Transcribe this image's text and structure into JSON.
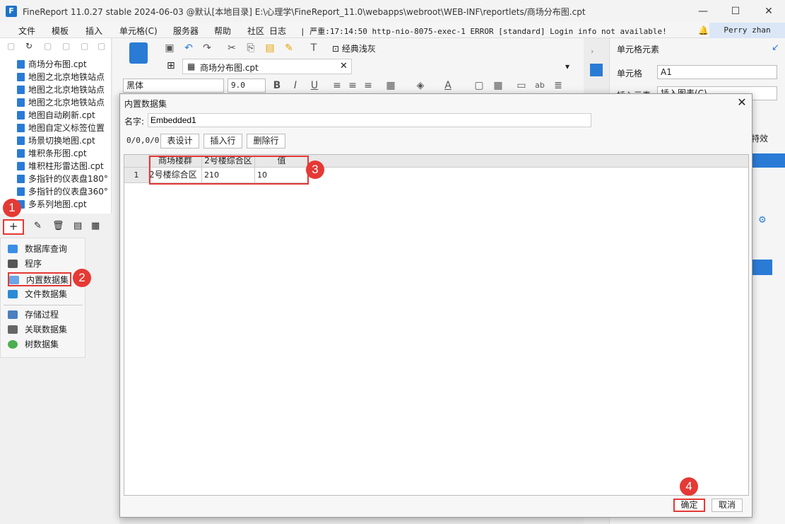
{
  "window": {
    "title": "FineReport 11.0.27 stable 2024-06-03 @默认[本地目录]    E:\\心理学\\FineReport_11.0\\webapps\\webroot\\WEB-INF\\reportlets/商场分布图.cpt",
    "minimize": "—",
    "maximize": "☐",
    "close": "✕"
  },
  "menu": {
    "items": [
      "文件",
      "模板",
      "插入",
      "单元格(C)",
      "服务器",
      "帮助",
      "社区"
    ],
    "log_label": "日志",
    "log_message": "| 严重:17:14:50 http-nio-8075-exec-1 ERROR [standard] Login info not available!",
    "user": "Perry zhan"
  },
  "tree": {
    "items": [
      "商场分布图.cpt",
      "地图之北京地铁站点",
      "地图之北京地铁站点",
      "地图之北京地铁站点",
      "地图自动刷新.cpt",
      "地图自定义标签位置",
      "场景切换地图.cpt",
      "堆积条形图.cpt",
      "堆积柱形雷达图.cpt",
      "多指针的仪表盘180°",
      "多指针的仪表盘360°",
      "多系列地图.cpt"
    ]
  },
  "datasource_menu": {
    "add_label": "+",
    "items": [
      "数据库查询",
      "程序",
      "内置数据集",
      "文件数据集",
      "存储过程",
      "关联数据集",
      "树数据集"
    ]
  },
  "editor": {
    "tab_label": "商场分布图.cpt",
    "style_label": "经典浅灰",
    "font_name": "黑体",
    "font_size": "9.0"
  },
  "right_panel": {
    "header": "单元格元素",
    "cell_label": "单元格",
    "cell_value": "A1",
    "insert_label": "插入元素",
    "insert_value": "插入图表(C)",
    "effect_label": "特效"
  },
  "dialog": {
    "title": "内置数据集",
    "name_label": "名字:",
    "name_value": "Embedded1",
    "row_counter": "0/0,0/0",
    "btn_design": "表设计",
    "btn_insert": "插入行",
    "btn_delete": "删除行",
    "columns": [
      "商场楼群",
      "2号楼综合区",
      "值"
    ],
    "rows": [
      {
        "index": "1",
        "cells": [
          "2号楼综合区",
          "210",
          "10"
        ]
      }
    ],
    "ok": "确定",
    "cancel": "取消"
  },
  "badges": [
    "1",
    "2",
    "3",
    "4"
  ],
  "colors": {
    "accent": "#1e73c8",
    "highlight": "#e53935"
  }
}
